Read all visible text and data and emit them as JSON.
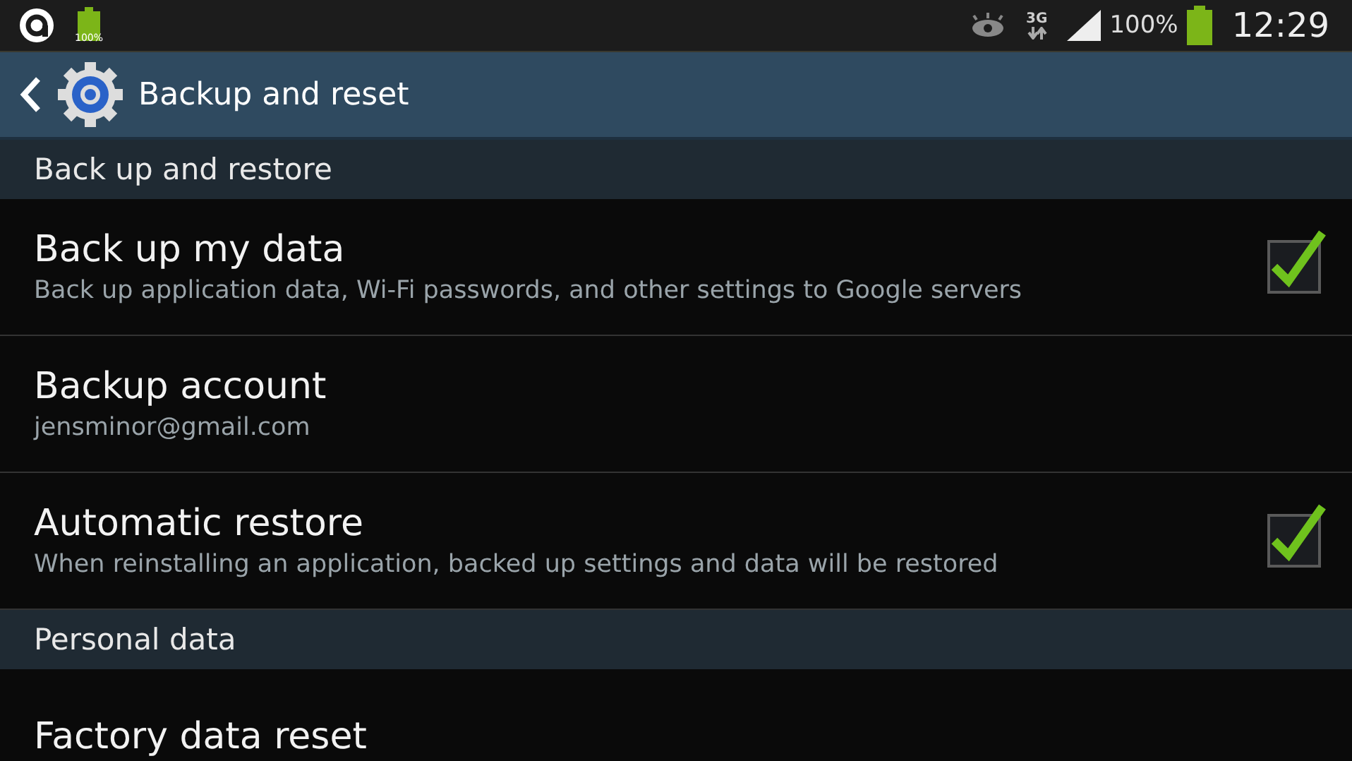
{
  "status_bar": {
    "battery_badge": "100%",
    "network": "3G",
    "battery_percent": "100%",
    "time": "12:29"
  },
  "action_bar": {
    "title": "Backup and reset"
  },
  "sections": [
    {
      "header": "Back up and restore",
      "items": [
        {
          "kind": "checkbox",
          "title": "Back up my data",
          "subtitle": "Back up application data, Wi-Fi passwords, and other settings to Google servers",
          "checked": true
        },
        {
          "kind": "plain",
          "title": "Backup account",
          "subtitle": "jensminor@gmail.com"
        },
        {
          "kind": "checkbox",
          "title": "Automatic restore",
          "subtitle": "When reinstalling an application, backed up settings and data will be restored",
          "checked": true
        }
      ]
    },
    {
      "header": "Personal data",
      "items": [
        {
          "kind": "plain",
          "title": "Factory data reset"
        }
      ]
    }
  ]
}
